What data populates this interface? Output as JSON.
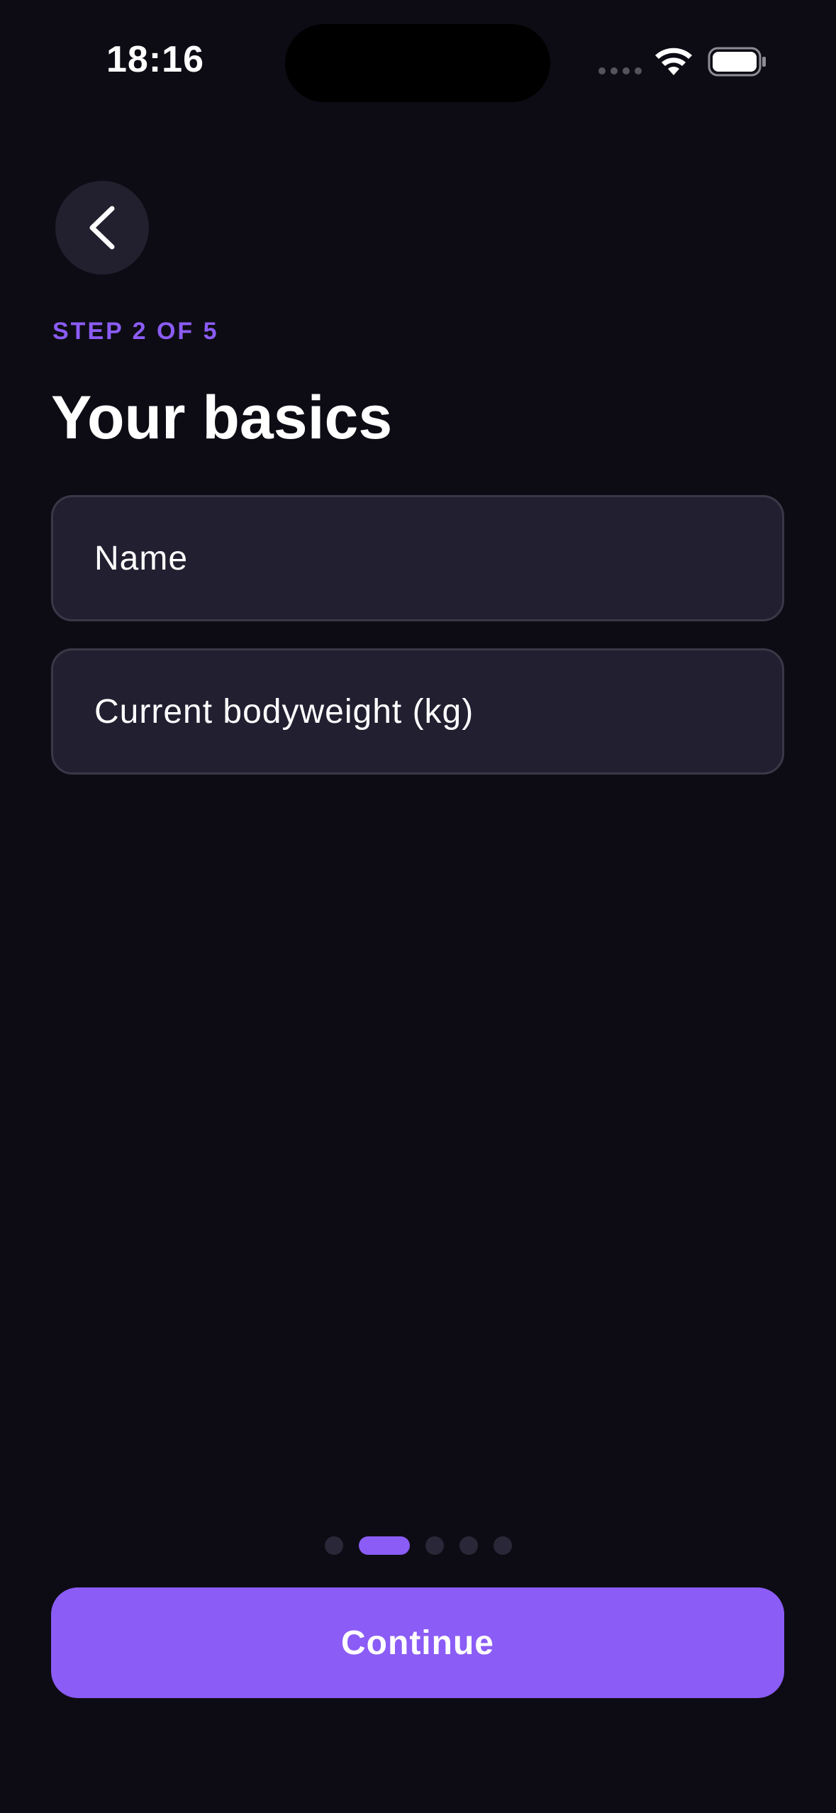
{
  "status_bar": {
    "time": "18:16",
    "icons": [
      "cellular-signal-icon",
      "wifi-icon",
      "battery-icon"
    ]
  },
  "header": {
    "back_icon": "chevron-left-icon",
    "step_label": "STEP 2 OF 5",
    "title": "Your basics"
  },
  "form": {
    "name_field": {
      "value": "",
      "placeholder": "Name"
    },
    "bodyweight_field": {
      "value": "",
      "placeholder": "Current bodyweight (kg)"
    }
  },
  "pager": {
    "total_steps": 5,
    "current_step": 2
  },
  "footer": {
    "continue_label": "Continue"
  },
  "colors": {
    "background": "#0d0c14",
    "surface": "#221f31",
    "field_border": "#3a3847",
    "accent": "#8b5cf6",
    "inactive_dot": "#2a2838",
    "text": "#ffffff"
  }
}
